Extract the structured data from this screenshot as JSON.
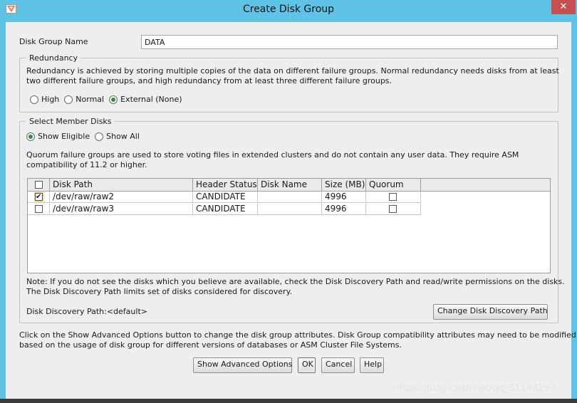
{
  "window": {
    "title": "Create Disk Group",
    "close_glyph": "✕"
  },
  "disk_group_name": {
    "label": "Disk Group Name",
    "value": "DATA"
  },
  "redundancy": {
    "legend": "Redundancy",
    "description_line1": "Redundancy is achieved by storing multiple copies of the data on different failure groups. Normal redundancy needs disks from at least",
    "description_line2": "two different failure groups, and high redundancy from at least three different failure groups.",
    "options": [
      {
        "label": "High",
        "selected": false
      },
      {
        "label": "Normal",
        "selected": false
      },
      {
        "label": "External (None)",
        "selected": true
      }
    ]
  },
  "member_disks": {
    "legend": "Select Member Disks",
    "filter_options": [
      {
        "label": "Show Eligible",
        "selected": true
      },
      {
        "label": "Show All",
        "selected": false
      }
    ],
    "quorum_note_line1": "Quorum failure groups are used to store voting files in extended clusters and do not contain any user data. They require ASM",
    "quorum_note_line2": "compatibility of 11.2 or higher.",
    "table": {
      "columns": [
        "",
        "Disk Path",
        "Header Status",
        "Disk Name",
        "Size (MB)",
        "Quorum"
      ],
      "rows": [
        {
          "selected": true,
          "disk_path": "/dev/raw/raw2",
          "header_status": "CANDIDATE",
          "disk_name": "",
          "size_mb": "4996",
          "quorum": false
        },
        {
          "selected": false,
          "disk_path": "/dev/raw/raw3",
          "header_status": "CANDIDATE",
          "disk_name": "",
          "size_mb": "4996",
          "quorum": false
        }
      ]
    },
    "discovery_note_line1": "Note: If you do not see the disks which you believe are available, check the Disk Discovery Path and read/write permissions on the disks.",
    "discovery_note_line2": "The Disk Discovery Path limits set of disks considered for discovery.",
    "discovery_path_label": "Disk Discovery Path:<default>",
    "change_path_button": "Change Disk Discovery Path"
  },
  "advanced_note_line1": "Click on the Show Advanced Options button to change the disk group attributes. Disk Group compatibility attributes may need to be modified",
  "advanced_note_line2": "based on the usage of disk group for different versions of databases or ASM Cluster File Systems.",
  "buttons": {
    "advanced": "Show Advanced Options",
    "ok": "OK",
    "cancel": "Cancel",
    "help": "Help"
  },
  "watermark": "https://blog.csdn.net/qq_31144297",
  "colors": {
    "titlebar": "#5fc3e6",
    "close_button": "#c7504f",
    "dialog_background": "#eeeeee",
    "radio_selected": "#3a8a3a"
  }
}
